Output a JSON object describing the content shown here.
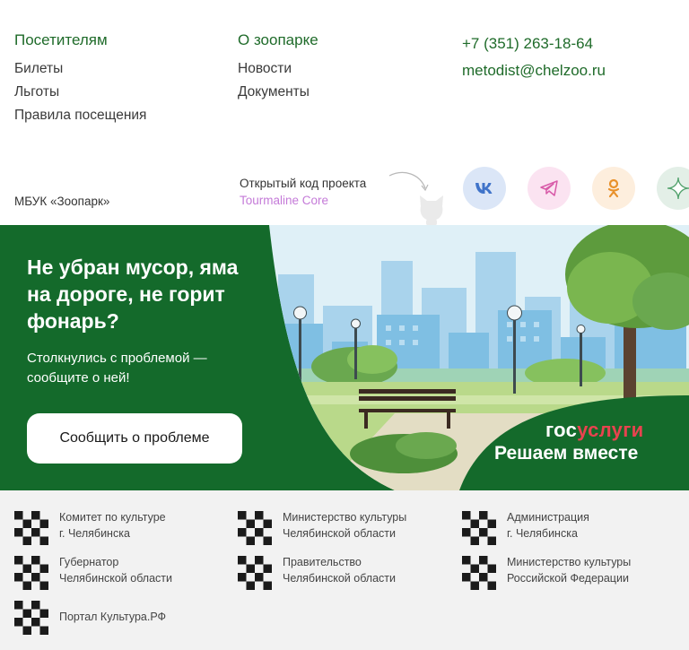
{
  "nav": {
    "visitors": {
      "title": "Посетителям",
      "links": [
        "Билеты",
        "Льготы",
        "Правила посещения"
      ]
    },
    "about": {
      "title": "О зоопарке",
      "links": [
        "Новости",
        "Документы"
      ]
    }
  },
  "contacts": {
    "phone": "+7 (351) 263-18-64",
    "email": "metodist@chelzoo.ru"
  },
  "org_name": "МБУК «Зоопарк»",
  "open_source": {
    "label": "Открытый код проекта",
    "link": "Tourmaline Core"
  },
  "socials": [
    {
      "icon": "vk-icon",
      "color": "#dbe6f7"
    },
    {
      "icon": "telegram-icon",
      "color": "#fbe3f1"
    },
    {
      "icon": "odnoklassniki-icon",
      "color": "#fdeedd"
    },
    {
      "icon": "star-icon",
      "color": "#e3efe7"
    }
  ],
  "banner": {
    "title": "Не убран мусор, яма на дороге, не горит фонарь?",
    "subtitle": "Столкнулись с проблемой — сообщите о ней!",
    "button": "Сообщить о проблеме",
    "logo_part1": "гос",
    "logo_part2": "услуги",
    "tagline": "Решаем вместе"
  },
  "partners": [
    {
      "line1": "Комитет по культуре",
      "line2": " г. Челябинска"
    },
    {
      "line1": "Министерство культуры",
      "line2": "Челябинской области"
    },
    {
      "line1": "Администрация",
      "line2": "г. Челябинска"
    },
    {
      "line1": "Губернатор",
      "line2": "Челябинской области"
    },
    {
      "line1": "Правительство",
      "line2": "Челябинской области"
    },
    {
      "line1": "Министерство культуры",
      "line2": "Российской Федерации"
    },
    {
      "line1": "Портал Культура.РФ",
      "line2": ""
    }
  ],
  "colors": {
    "brand_green": "#146a2b",
    "text_green": "#1f6b2a",
    "accent_red": "#e8434f"
  }
}
